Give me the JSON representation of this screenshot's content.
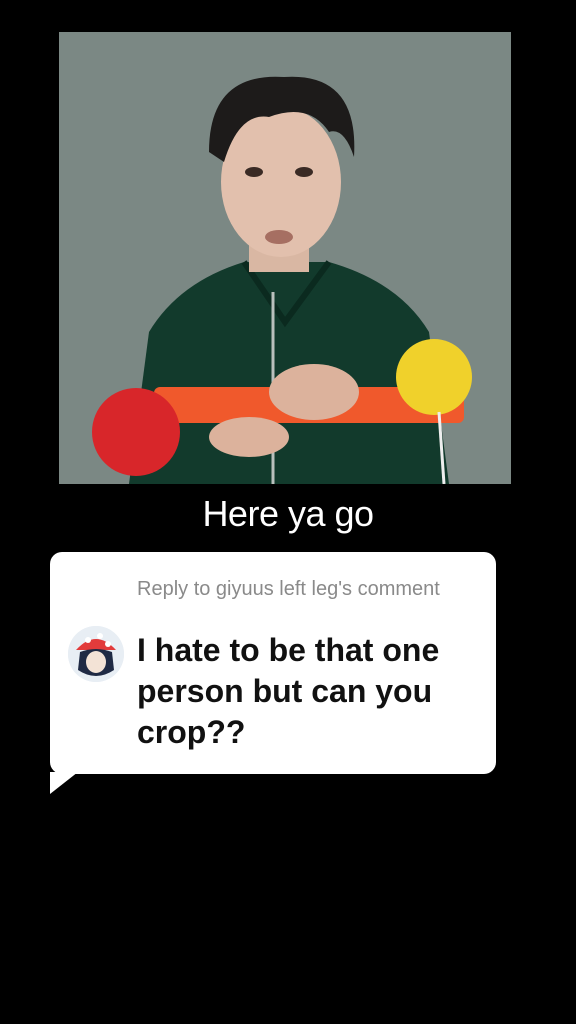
{
  "video": {
    "caption": "Here ya go"
  },
  "reply": {
    "meta": "Reply to giyuus left leg's comment",
    "comment": "I hate to be that one person but can you crop??"
  }
}
